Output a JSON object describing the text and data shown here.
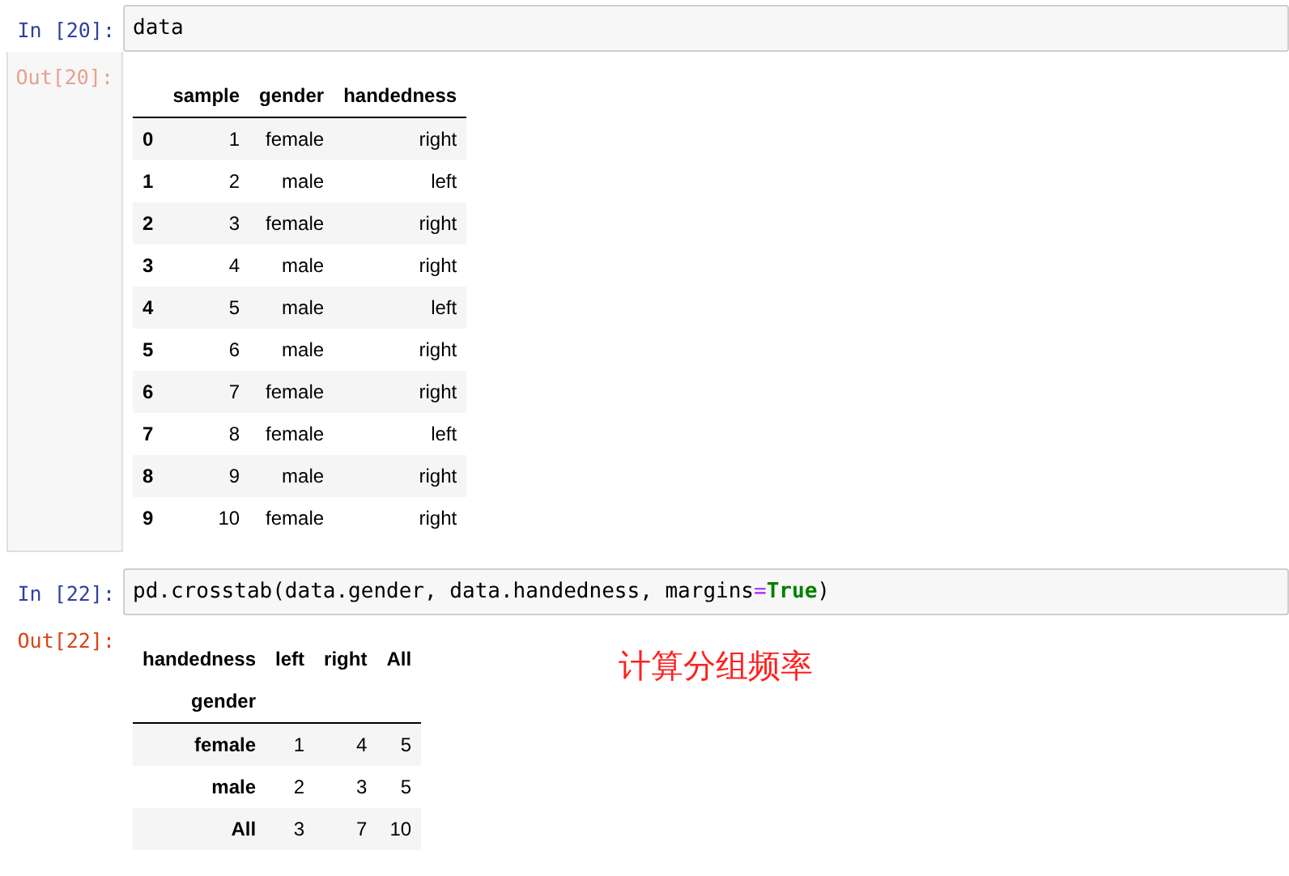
{
  "cells": [
    {
      "input_prompt": "In [20]:",
      "code": [
        {
          "text": "data",
          "kind": "plain"
        }
      ],
      "output_prompt": "Out[20]:",
      "output_scrolled": true,
      "table": {
        "kind": "simple",
        "columns": [
          "sample",
          "gender",
          "handedness"
        ],
        "rows": [
          {
            "index": "0",
            "cells": [
              "1",
              "female",
              "right"
            ]
          },
          {
            "index": "1",
            "cells": [
              "2",
              "male",
              "left"
            ]
          },
          {
            "index": "2",
            "cells": [
              "3",
              "female",
              "right"
            ]
          },
          {
            "index": "3",
            "cells": [
              "4",
              "male",
              "right"
            ]
          },
          {
            "index": "4",
            "cells": [
              "5",
              "male",
              "left"
            ]
          },
          {
            "index": "5",
            "cells": [
              "6",
              "male",
              "right"
            ]
          },
          {
            "index": "6",
            "cells": [
              "7",
              "female",
              "right"
            ]
          },
          {
            "index": "7",
            "cells": [
              "8",
              "female",
              "left"
            ]
          },
          {
            "index": "8",
            "cells": [
              "9",
              "male",
              "right"
            ]
          },
          {
            "index": "9",
            "cells": [
              "10",
              "female",
              "right"
            ]
          }
        ]
      }
    },
    {
      "input_prompt": "In [22]:",
      "code": [
        {
          "text": "pd.crosstab(data.gender, data.handedness, margins",
          "kind": "plain"
        },
        {
          "text": "=",
          "kind": "operator"
        },
        {
          "text": "True",
          "kind": "keyword"
        },
        {
          "text": ")",
          "kind": "plain"
        }
      ],
      "output_prompt": "Out[22]:",
      "output_scrolled": false,
      "table": {
        "kind": "crosstab",
        "columns_name": "handedness",
        "columns": [
          "left",
          "right",
          "All"
        ],
        "index_name": "gender",
        "rows": [
          {
            "index": "female",
            "cells": [
              "1",
              "4",
              "5"
            ]
          },
          {
            "index": "male",
            "cells": [
              "2",
              "3",
              "5"
            ]
          },
          {
            "index": "All",
            "cells": [
              "3",
              "7",
              "10"
            ]
          }
        ]
      },
      "annotation": "计算分组频率"
    }
  ]
}
